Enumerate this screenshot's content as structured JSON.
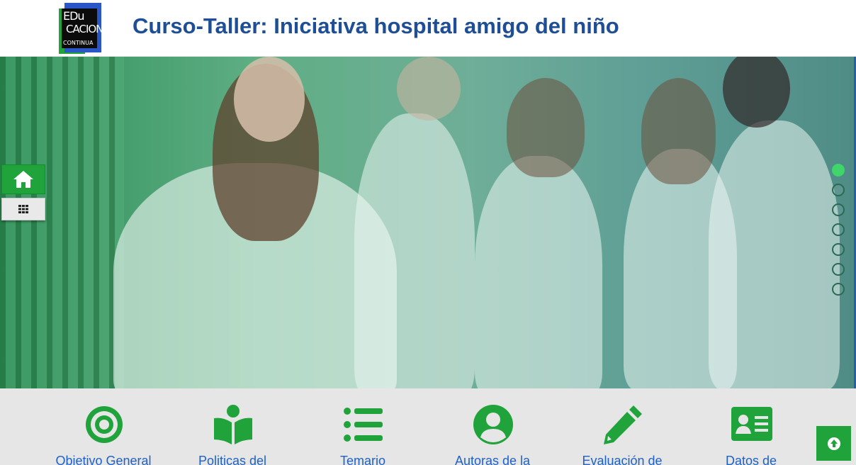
{
  "header": {
    "logo_line1": "EDu",
    "logo_line2": "CACION",
    "logo_line3": "CONTINUA",
    "title": "Curso-Taller: Iniciativa hospital amigo del niño"
  },
  "hero": {
    "slide_count": 7,
    "active_slide": 1
  },
  "side_nav": {
    "home_icon": "home-icon",
    "grid_icon": "grid-icon"
  },
  "features": [
    {
      "label": "Objetivo General",
      "icon": "target-icon"
    },
    {
      "label": "Politicas del",
      "icon": "book-reader-icon"
    },
    {
      "label": "Temario",
      "icon": "list-icon"
    },
    {
      "label": "Autoras de la",
      "icon": "user-circle-icon"
    },
    {
      "label": "Evaluación de",
      "icon": "pencil-icon"
    },
    {
      "label": "Datos de",
      "icon": "id-card-icon"
    }
  ],
  "colors": {
    "brand_green": "#1fa33a",
    "title_blue": "#1d4e96",
    "link_blue": "#1f62c4",
    "dot_active": "#3fd56b"
  }
}
